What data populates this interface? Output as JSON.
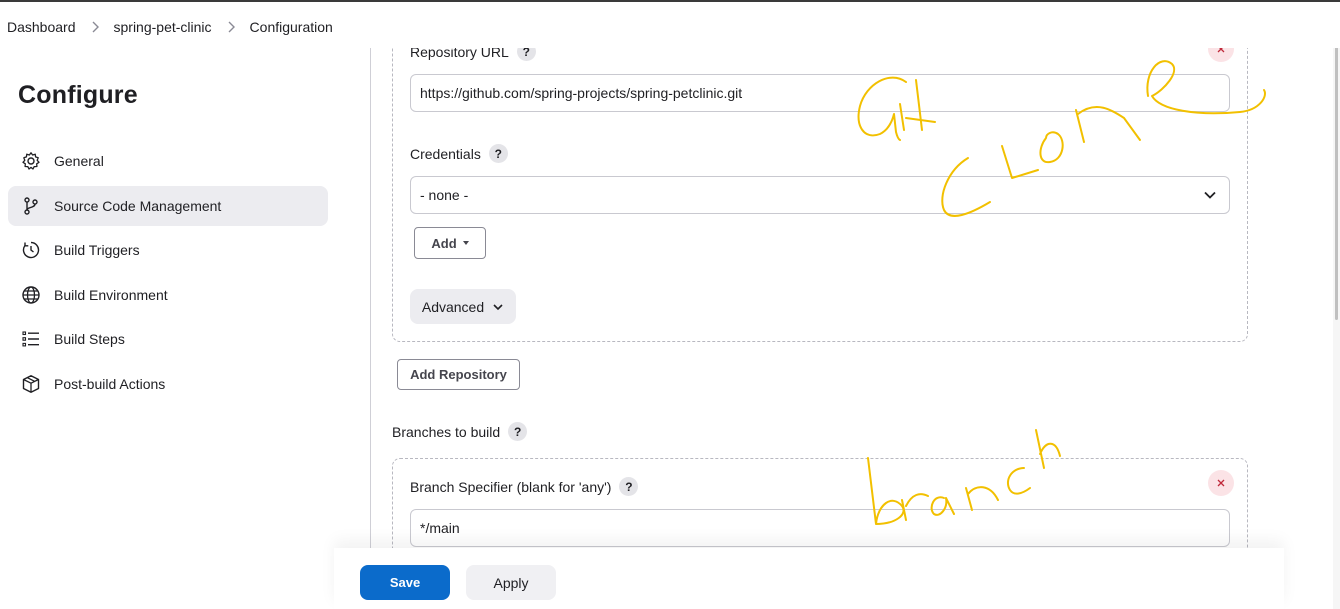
{
  "breadcrumb": {
    "items": [
      "Dashboard",
      "spring-pet-clinic",
      "Configuration"
    ]
  },
  "sidebar": {
    "title": "Configure",
    "items": [
      {
        "label": "General",
        "icon": "gear-icon"
      },
      {
        "label": "Source Code Management",
        "icon": "git-branch-icon",
        "active": true
      },
      {
        "label": "Build Triggers",
        "icon": "clock-icon"
      },
      {
        "label": "Build Environment",
        "icon": "globe-icon"
      },
      {
        "label": "Build Steps",
        "icon": "list-icon"
      },
      {
        "label": "Post-build Actions",
        "icon": "package-icon"
      }
    ]
  },
  "repository": {
    "url_label": "Repository URL",
    "url_value": "https://github.com/spring-projects/spring-petclinic.git",
    "credentials_label": "Credentials",
    "credentials_value": "- none -",
    "add_label": "Add",
    "advanced_label": "Advanced",
    "help": "?"
  },
  "add_repository_label": "Add Repository",
  "branches": {
    "section_label": "Branches to build",
    "specifier_label": "Branch Specifier (blank for 'any')",
    "specifier_value": "*/main",
    "help": "?"
  },
  "actions": {
    "save_label": "Save",
    "apply_label": "Apply"
  },
  "colors": {
    "primary": "#0b6bcb",
    "annotation": "#f2c000",
    "active_nav": "#ececf0"
  }
}
